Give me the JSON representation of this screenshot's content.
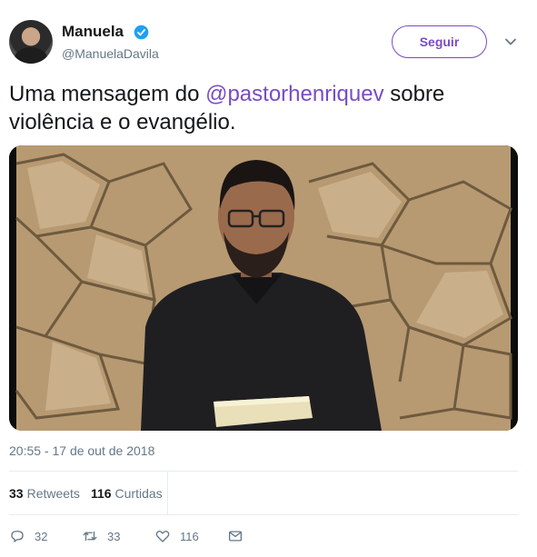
{
  "user": {
    "name": "Manuela",
    "handle": "@ManuelaDavila",
    "follow_label": "Seguir"
  },
  "tweet": {
    "text_before": "Uma mensagem do ",
    "mention": "@pastorhenriquev",
    "text_after": " sobre violência e o evangélio.",
    "timestamp": "20:55 - 17 de out de 2018"
  },
  "stats": {
    "retweets_count": "33",
    "retweets_label": "Retweets",
    "likes_count": "116",
    "likes_label": "Curtidas"
  },
  "actions": {
    "reply_count": "32",
    "retweet_count": "33",
    "like_count": "116"
  },
  "colors": {
    "accent": "#794bc4",
    "verified": "#1da1f2",
    "muted": "#657786"
  },
  "icons": [
    "verified-icon",
    "chevron-down-icon",
    "reply-icon",
    "retweet-icon",
    "like-icon",
    "message-icon"
  ]
}
